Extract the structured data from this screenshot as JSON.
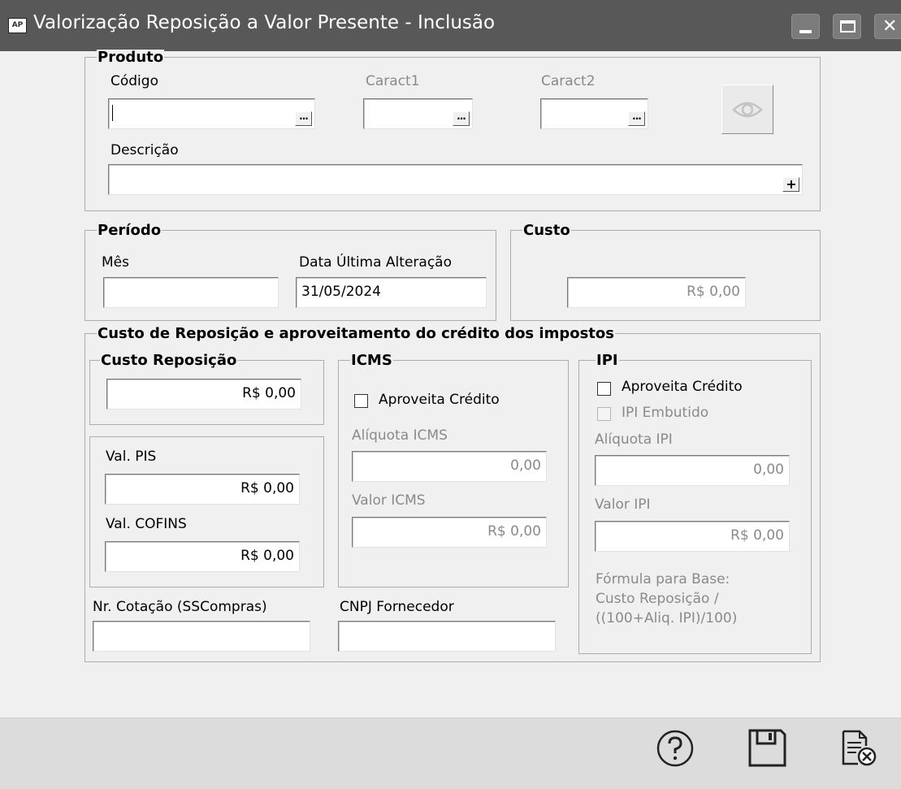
{
  "window": {
    "title": "Valorização Reposição a Valor Presente - Inclusão",
    "app_badge": "AP"
  },
  "produto": {
    "legend": "Produto",
    "codigo_label": "Código",
    "codigo_value": "",
    "caract1_label": "Caract1",
    "caract2_label": "Caract2",
    "descricao_label": "Descrição",
    "descricao_value": "",
    "ellipsis": "...",
    "plus": "+"
  },
  "periodo": {
    "legend": "Período",
    "mes_label": "Mês",
    "mes_value": "",
    "data_label": "Data Última Alteração",
    "data_value": "31/05/2024"
  },
  "custo": {
    "legend": "Custo",
    "value": "R$ 0,00"
  },
  "reposicao": {
    "legend": "Custo de Reposição e aproveitamento do crédito dos impostos",
    "custo_rep_legend": "Custo Reposição",
    "custo_rep_value": "R$ 0,00",
    "pis_label": "Val. PIS",
    "pis_value": "R$ 0,00",
    "cofins_label": "Val. COFINS",
    "cofins_value": "R$ 0,00",
    "cotacao_label": "Nr. Cotação (SSCompras)",
    "cotacao_value": "",
    "cnpj_label": "CNPJ Fornecedor",
    "cnpj_value": ""
  },
  "icms": {
    "legend": "ICMS",
    "aproveita_label": "Aproveita Crédito",
    "aproveita_checked": false,
    "aliquota_label": "Alíquota ICMS",
    "aliquota_value": "0,00",
    "valor_label": "Valor ICMS",
    "valor_value": "R$ 0,00"
  },
  "ipi": {
    "legend": "IPI",
    "aproveita_label": "Aproveita Crédito",
    "aproveita_checked": false,
    "embutido_label": "IPI Embutido",
    "embutido_checked": false,
    "aliquota_label": "Alíquota IPI",
    "aliquota_value": "0,00",
    "valor_label": "Valor IPI",
    "valor_value": "R$ 0,00",
    "formula_line1": "Fórmula para Base:",
    "formula_line2": "Custo Reposição /",
    "formula_line3": "((100+Aliq. IPI)/100)"
  },
  "toolbar": {
    "help_icon": "help-icon",
    "save_icon": "save-icon",
    "cancel_icon": "cancel-document-icon"
  },
  "colors": {
    "titlebar": "#585858",
    "background": "#f0f0f0",
    "disabled_text": "#8a8a8a",
    "statusbar": "#dcdcdc"
  }
}
